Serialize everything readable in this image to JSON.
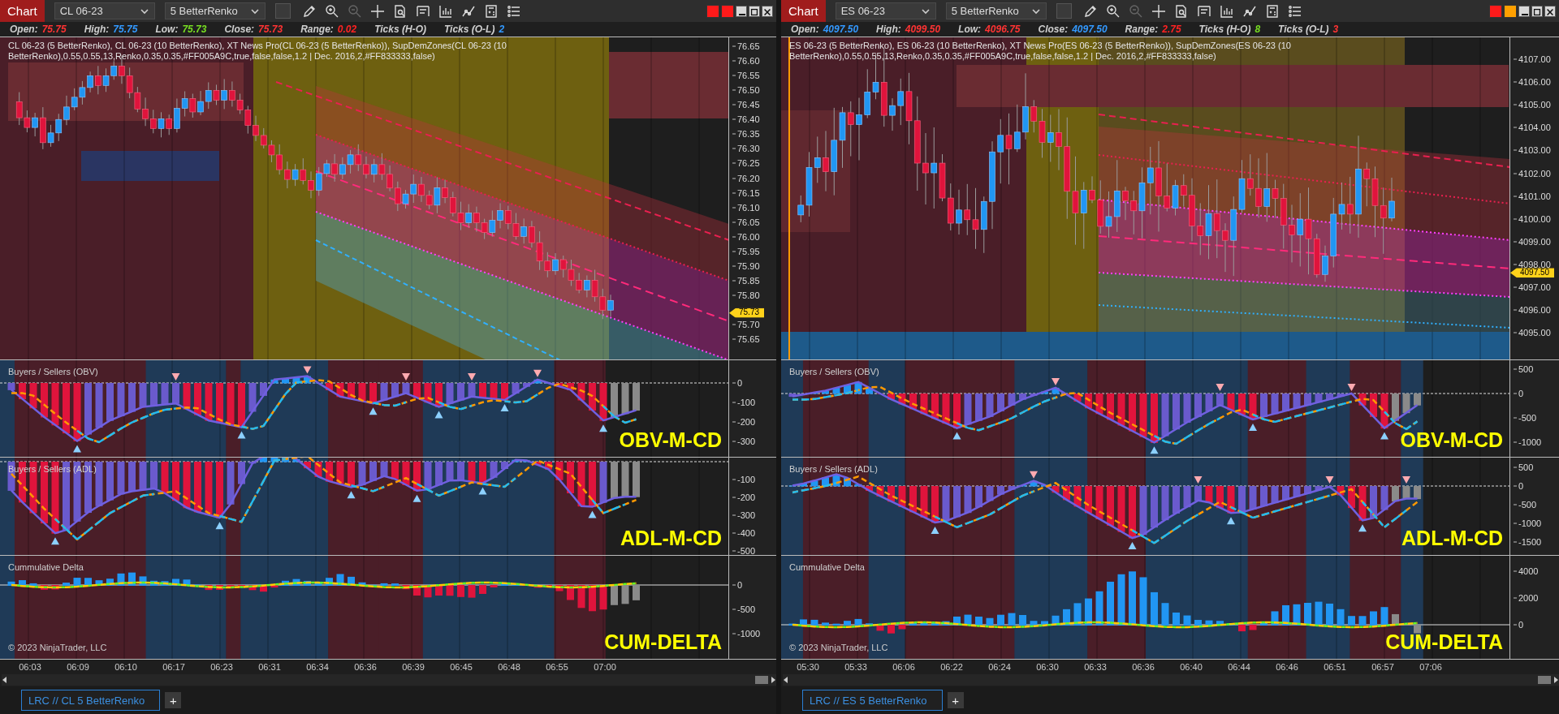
{
  "charts": [
    {
      "chart_button": "Chart",
      "instrument": "CL 06-23",
      "bar_type": "5 BetterRenko",
      "status_lights": [
        {
          "color": "#ff1a1a"
        },
        {
          "color": "#ff1a1a"
        }
      ],
      "ohlc": [
        {
          "label": "Open:",
          "value": "75.75",
          "color": "#ff3333"
        },
        {
          "label": "High:",
          "value": "75.75",
          "color": "#3399ff"
        },
        {
          "label": "Low:",
          "value": "75.73",
          "color": "#77dd22"
        },
        {
          "label": "Close:",
          "value": "75.73",
          "color": "#ff3333"
        },
        {
          "label": "Range:",
          "value": "0.02",
          "color": "#ff2222"
        },
        {
          "label": "Ticks (H-O)"
        },
        {
          "label": "Ticks (O-L)",
          "value": "2",
          "color": "#3399ff"
        }
      ],
      "legend": "CL 06-23 (5 BetterRenko), CL 06-23 (10 BetterRenko), XT News Pro(CL 06-23 (5 BetterRenko)), SupDemZones(CL 06-23 (10 BetterRenko),0.55,0.55,13,Renko,0.35,0.35,#FF005A9C,true,false,false,1.2 | Dec. 2016,2,#FF833333,false)",
      "price_axis": [
        "76.65",
        "76.60",
        "76.55",
        "76.50",
        "76.45",
        "76.40",
        "76.35",
        "76.30",
        "76.25",
        "76.20",
        "76.15",
        "76.10",
        "76.05",
        "76.00",
        "75.95",
        "75.90",
        "75.85",
        "75.80",
        "75.70",
        "75.65"
      ],
      "price_marker": "75.73",
      "panels": [
        {
          "kind": "oscillator",
          "title": "Buyers /  Sellers (OBV)",
          "label": "OBV-M-CD",
          "axis": [
            "0",
            "-100",
            "-200",
            "-300"
          ]
        },
        {
          "kind": "oscillator",
          "title": "Buyers /  Sellers (ADL)",
          "label": "ADL-M-CD",
          "axis": [
            "-100",
            "-200",
            "-300",
            "-400",
            "-500"
          ]
        },
        {
          "kind": "delta",
          "title": "Cummulative Delta",
          "label": "CUM-DELTA",
          "axis": [
            "0",
            "-500",
            "-1000"
          ],
          "copyright": "© 2023 NinjaTrader, LLC"
        }
      ],
      "time_axis": [
        "06:03",
        "06:09",
        "06:10",
        "06:17",
        "06:23",
        "06:31",
        "06:34",
        "06:36",
        "06:39",
        "06:45",
        "06:48",
        "06:55",
        "07:00"
      ],
      "tabs": [
        {
          "label": "LRC // CL  5 BetterRenko",
          "selected": true
        }
      ],
      "add_tab": "+"
    },
    {
      "chart_button": "Chart",
      "instrument": "ES 06-23",
      "bar_type": "5 BetterRenko",
      "status_lights": [
        {
          "color": "#ff1a1a"
        },
        {
          "color": "#ffa000"
        }
      ],
      "ohlc": [
        {
          "label": "Open:",
          "value": "4097.50",
          "color": "#3399ff"
        },
        {
          "label": "High:",
          "value": "4099.50",
          "color": "#ff3333"
        },
        {
          "label": "Low:",
          "value": "4096.75",
          "color": "#ff3333"
        },
        {
          "label": "Close:",
          "value": "4097.50",
          "color": "#3399ff"
        },
        {
          "label": "Range:",
          "value": "2.75",
          "color": "#ff2222"
        },
        {
          "label": "Ticks (H-O)",
          "value": "8",
          "color": "#77dd22"
        },
        {
          "label": "Ticks (O-L)",
          "value": "3",
          "color": "#ff3333"
        }
      ],
      "legend": "ES 06-23 (5 BetterRenko), ES 06-23 (10 BetterRenko), XT News Pro(ES 06-23 (5 BetterRenko)), SupDemZones(ES 06-23 (10 BetterRenko),0.55,0.55,13,Renko,0.35,0.35,#FF005A9C,true,false,false,1.2 | Dec. 2016,2,#FF833333,false)",
      "price_axis": [
        "4107.00",
        "4106.00",
        "4105.00",
        "4104.00",
        "4103.00",
        "4102.00",
        "4101.00",
        "4100.00",
        "4099.00",
        "4098.00",
        "4097.00",
        "4096.00",
        "4095.00"
      ],
      "price_marker": "4097.50",
      "panels": [
        {
          "kind": "oscillator",
          "title": "Buyers /  Sellers (OBV)",
          "label": "OBV-M-CD",
          "axis": [
            "500",
            "0",
            "-500",
            "-1000"
          ]
        },
        {
          "kind": "oscillator",
          "title": "Buyers /  Sellers (ADL)",
          "label": "ADL-M-CD",
          "axis": [
            "500",
            "0",
            "-500",
            "-1000",
            "-1500"
          ]
        },
        {
          "kind": "delta",
          "title": "Cummulative Delta",
          "label": "CUM-DELTA",
          "axis": [
            "4000",
            "2000",
            "0"
          ],
          "copyright": "© 2023 NinjaTrader, LLC"
        }
      ],
      "time_axis": [
        "05:30",
        "05:33",
        "06:06",
        "06:22",
        "06:24",
        "06:30",
        "06:33",
        "06:36",
        "06:40",
        "06:44",
        "06:46",
        "06:51",
        "06:57",
        "07:06"
      ],
      "tabs": [
        {
          "label": "LRC // ES  5 BetterRenko",
          "selected": true
        }
      ],
      "add_tab": "+"
    }
  ]
}
